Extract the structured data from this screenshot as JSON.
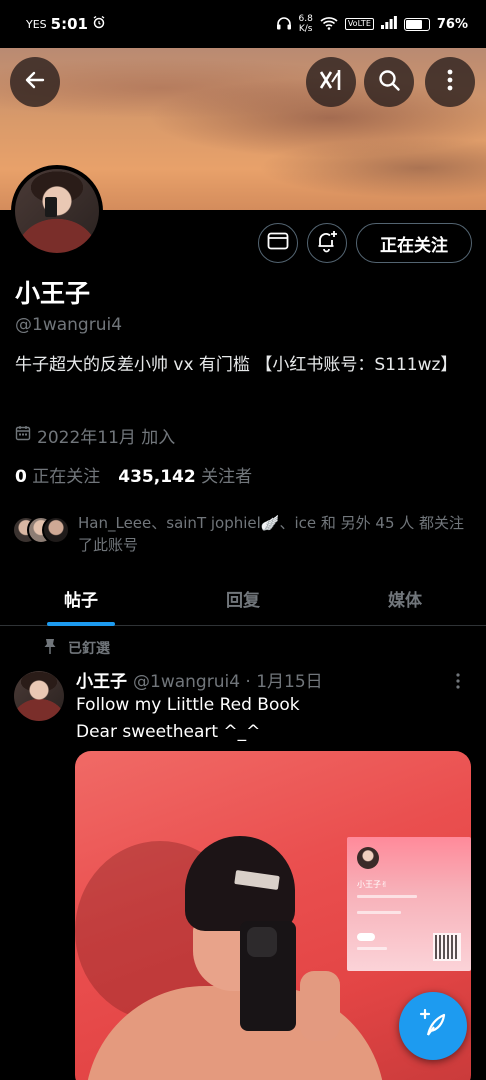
{
  "status_bar": {
    "carrier": "YES",
    "time": "5:01",
    "net_speed_value": "6.8",
    "net_speed_unit": "K/s",
    "volte": "VoLTE",
    "battery_text": "76%",
    "battery_level": 0.76
  },
  "profile": {
    "display_name": "小王子",
    "handle": "@1wangrui4",
    "bio": "牛子超大的反差小帅 vx 有门槛 【小红书账号：S111wz】",
    "joined": "2022年11月 加入",
    "following_count": "0",
    "following_label": "正在关注",
    "followers_count": "435,142",
    "followers_label": "关注者",
    "followed_by_text": "Han_Leee、sainT jophiel🪽、ice 和 另外 45 人 都关注了此账号",
    "follow_button_label": "正在关注"
  },
  "tabs": [
    {
      "label": "帖子",
      "active": true
    },
    {
      "label": "回复",
      "active": false
    },
    {
      "label": "媒体",
      "active": false
    }
  ],
  "post": {
    "pinned_label": "已釘選",
    "author_name": "小王子",
    "author_meta": "@1wangrui4 · 1月15日",
    "text_line1": "Follow my Liittle Red Book",
    "text_line2": "Dear sweetheart ^_^",
    "card_name": "小王子✌"
  },
  "colors": {
    "accent": "#1d9bf0",
    "secondary_text": "#71767b",
    "background": "#000000"
  },
  "icons": {
    "back": "arrow-left-icon",
    "grok": "grok-icon",
    "search": "search-icon",
    "more": "more-vertical-icon",
    "message": "envelope-icon",
    "notify": "bell-plus-icon",
    "calendar": "calendar-icon",
    "pin": "pin-icon",
    "compose": "feather-plus-icon"
  }
}
